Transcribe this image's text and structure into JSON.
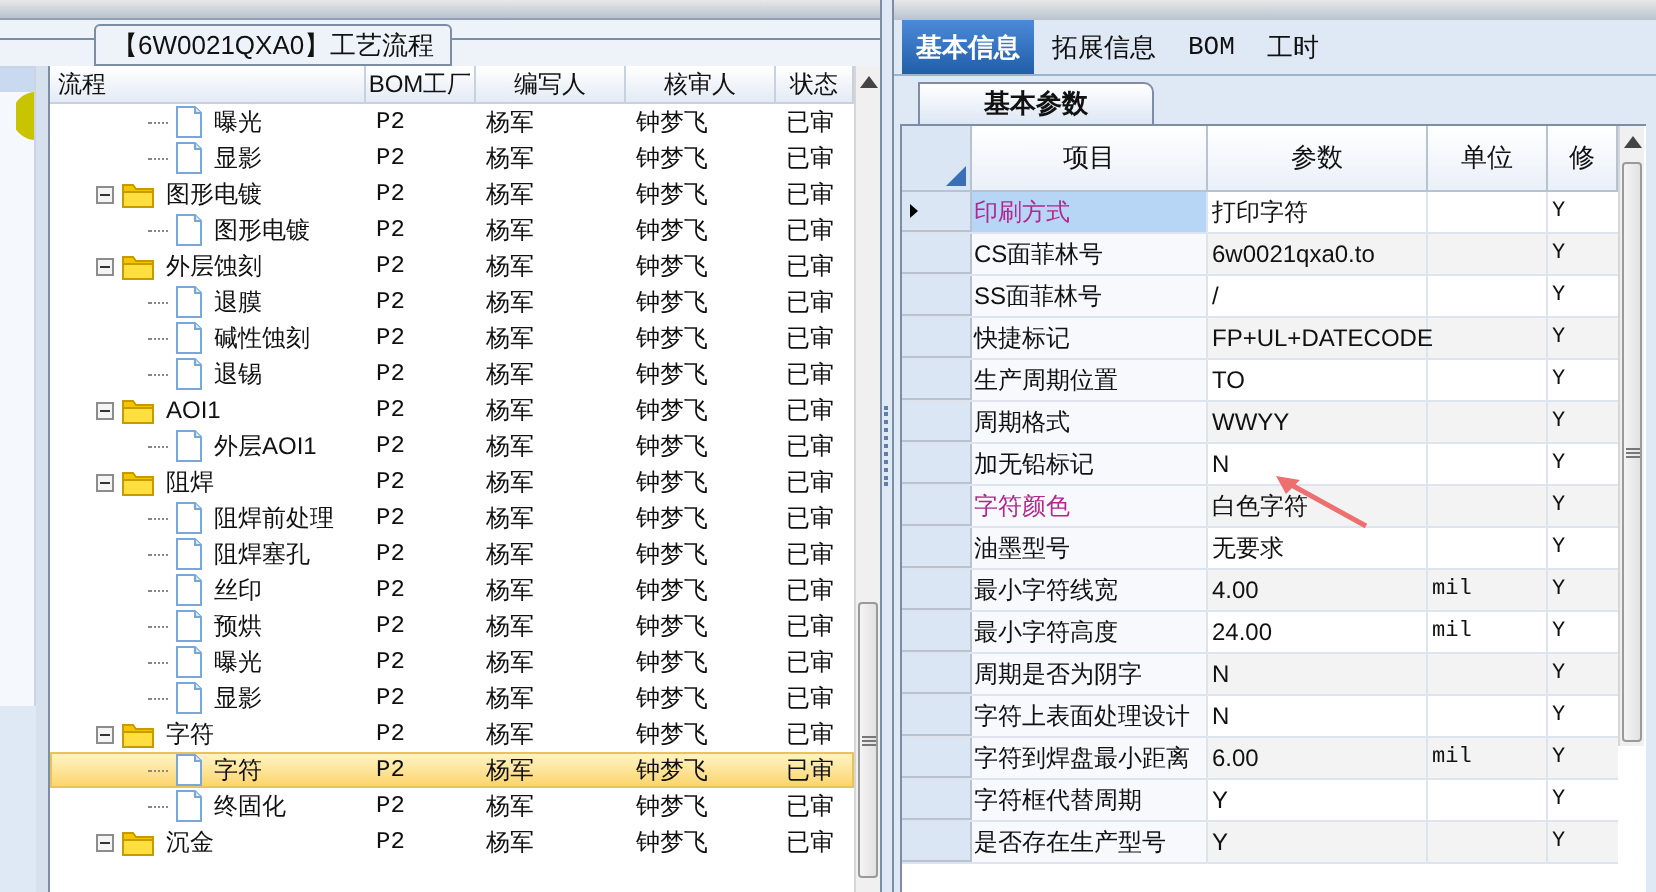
{
  "left_panel": {
    "title": "【6W0021QXA0】工艺流程",
    "columns": [
      "流程",
      "BOM工厂",
      "编写人",
      "核审人",
      "状态"
    ],
    "tree": [
      {
        "kind": "group",
        "children": [
          {
            "kind": "file",
            "label": "曝光",
            "bom": "P2",
            "writer": "杨军",
            "reviewer": "钟梦飞",
            "status": "已审",
            "selected": false
          },
          {
            "kind": "file",
            "label": "显影",
            "bom": "P2",
            "writer": "杨军",
            "reviewer": "钟梦飞",
            "status": "已审",
            "selected": false
          }
        ]
      },
      {
        "kind": "folder",
        "label": "图形电镀",
        "bom": "P2",
        "writer": "杨军",
        "reviewer": "钟梦飞",
        "status": "已审",
        "selected": false,
        "expanded": true,
        "children": [
          {
            "kind": "file",
            "label": "图形电镀",
            "bom": "P2",
            "writer": "杨军",
            "reviewer": "钟梦飞",
            "status": "已审",
            "selected": false
          }
        ]
      },
      {
        "kind": "folder",
        "label": "外层蚀刻",
        "bom": "P2",
        "writer": "杨军",
        "reviewer": "钟梦飞",
        "status": "已审",
        "selected": false,
        "expanded": true,
        "children": [
          {
            "kind": "file",
            "label": "退膜",
            "bom": "P2",
            "writer": "杨军",
            "reviewer": "钟梦飞",
            "status": "已审",
            "selected": false
          },
          {
            "kind": "file",
            "label": "碱性蚀刻",
            "bom": "P2",
            "writer": "杨军",
            "reviewer": "钟梦飞",
            "status": "已审",
            "selected": false
          },
          {
            "kind": "file",
            "label": "退锡",
            "bom": "P2",
            "writer": "杨军",
            "reviewer": "钟梦飞",
            "status": "已审",
            "selected": false
          }
        ]
      },
      {
        "kind": "folder",
        "label": "AOI1",
        "bom": "P2",
        "writer": "杨军",
        "reviewer": "钟梦飞",
        "status": "已审",
        "selected": false,
        "expanded": true,
        "children": [
          {
            "kind": "file",
            "label": "外层AOI1",
            "bom": "P2",
            "writer": "杨军",
            "reviewer": "钟梦飞",
            "status": "已审",
            "selected": false
          }
        ]
      },
      {
        "kind": "folder",
        "label": "阻焊",
        "bom": "P2",
        "writer": "杨军",
        "reviewer": "钟梦飞",
        "status": "已审",
        "selected": false,
        "expanded": true,
        "children": [
          {
            "kind": "file",
            "label": "阻焊前处理",
            "bom": "P2",
            "writer": "杨军",
            "reviewer": "钟梦飞",
            "status": "已审",
            "selected": false
          },
          {
            "kind": "file",
            "label": "阻焊塞孔",
            "bom": "P2",
            "writer": "杨军",
            "reviewer": "钟梦飞",
            "status": "已审",
            "selected": false
          },
          {
            "kind": "file",
            "label": "丝印",
            "bom": "P2",
            "writer": "杨军",
            "reviewer": "钟梦飞",
            "status": "已审",
            "selected": false
          },
          {
            "kind": "file",
            "label": "预烘",
            "bom": "P2",
            "writer": "杨军",
            "reviewer": "钟梦飞",
            "status": "已审",
            "selected": false
          },
          {
            "kind": "file",
            "label": "曝光",
            "bom": "P2",
            "writer": "杨军",
            "reviewer": "钟梦飞",
            "status": "已审",
            "selected": false
          },
          {
            "kind": "file",
            "label": "显影",
            "bom": "P2",
            "writer": "杨军",
            "reviewer": "钟梦飞",
            "status": "已审",
            "selected": false
          }
        ]
      },
      {
        "kind": "folder",
        "label": "字符",
        "bom": "P2",
        "writer": "杨军",
        "reviewer": "钟梦飞",
        "status": "已审",
        "selected": false,
        "expanded": true,
        "children": [
          {
            "kind": "file",
            "label": "字符",
            "bom": "P2",
            "writer": "杨军",
            "reviewer": "钟梦飞",
            "status": "已审",
            "selected": true
          },
          {
            "kind": "file",
            "label": "终固化",
            "bom": "P2",
            "writer": "杨军",
            "reviewer": "钟梦飞",
            "status": "已审",
            "selected": false
          }
        ]
      },
      {
        "kind": "folder",
        "label": "沉金",
        "bom": "P2",
        "writer": "杨军",
        "reviewer": "钟梦飞",
        "status": "已审",
        "selected": false,
        "expanded": true
      }
    ]
  },
  "right_panel": {
    "tabs": [
      {
        "label": "基本信息",
        "selected": true
      },
      {
        "label": "拓展信息",
        "selected": false
      },
      {
        "label": "BOM",
        "selected": false
      },
      {
        "label": "工时",
        "selected": false
      }
    ],
    "subtab": "基本参数",
    "columns": [
      "项目",
      "参数",
      "单位",
      "修"
    ],
    "rows": [
      {
        "item": "印刷方式",
        "value": "打印字符",
        "unit": "",
        "modify": "Y",
        "highlighted": true,
        "selected": true
      },
      {
        "item": "CS面菲林号",
        "value": "6w0021qxa0.to",
        "unit": "",
        "modify": "Y",
        "highlighted": false,
        "selected": false
      },
      {
        "item": "SS面菲林号",
        "value": "/",
        "unit": "",
        "modify": "Y",
        "highlighted": false,
        "selected": false
      },
      {
        "item": "快捷标记",
        "value": "FP+UL+DATECODE",
        "unit": "",
        "modify": "Y",
        "highlighted": false,
        "selected": false
      },
      {
        "item": "生产周期位置",
        "value": "TO",
        "unit": "",
        "modify": "Y",
        "highlighted": false,
        "selected": false
      },
      {
        "item": "周期格式",
        "value": "WWYY",
        "unit": "",
        "modify": "Y",
        "highlighted": false,
        "selected": false
      },
      {
        "item": "加无铅标记",
        "value": "N",
        "unit": "",
        "modify": "Y",
        "highlighted": false,
        "selected": false
      },
      {
        "item": "字符颜色",
        "value": "白色字符",
        "unit": "",
        "modify": "Y",
        "highlighted": true,
        "selected": false
      },
      {
        "item": "油墨型号",
        "value": "无要求",
        "unit": "",
        "modify": "Y",
        "highlighted": false,
        "selected": false
      },
      {
        "item": "最小字符线宽",
        "value": "4.00",
        "unit": "mil",
        "modify": "Y",
        "highlighted": false,
        "selected": false
      },
      {
        "item": "最小字符高度",
        "value": "24.00",
        "unit": "mil",
        "modify": "Y",
        "highlighted": false,
        "selected": false
      },
      {
        "item": "周期是否为阴字",
        "value": "N",
        "unit": "",
        "modify": "Y",
        "highlighted": false,
        "selected": false
      },
      {
        "item": "字符上表面处理设计",
        "value": "N",
        "unit": "",
        "modify": "Y",
        "highlighted": false,
        "selected": false
      },
      {
        "item": "字符到焊盘最小距离",
        "value": "6.00",
        "unit": "mil",
        "modify": "Y",
        "highlighted": false,
        "selected": false
      },
      {
        "item": "字符框代替周期",
        "value": "Y",
        "unit": "",
        "modify": "Y",
        "highlighted": false,
        "selected": false
      },
      {
        "item": "是否存在生产型号",
        "value": "Y",
        "unit": "",
        "modify": "Y",
        "highlighted": false,
        "selected": false
      }
    ]
  }
}
